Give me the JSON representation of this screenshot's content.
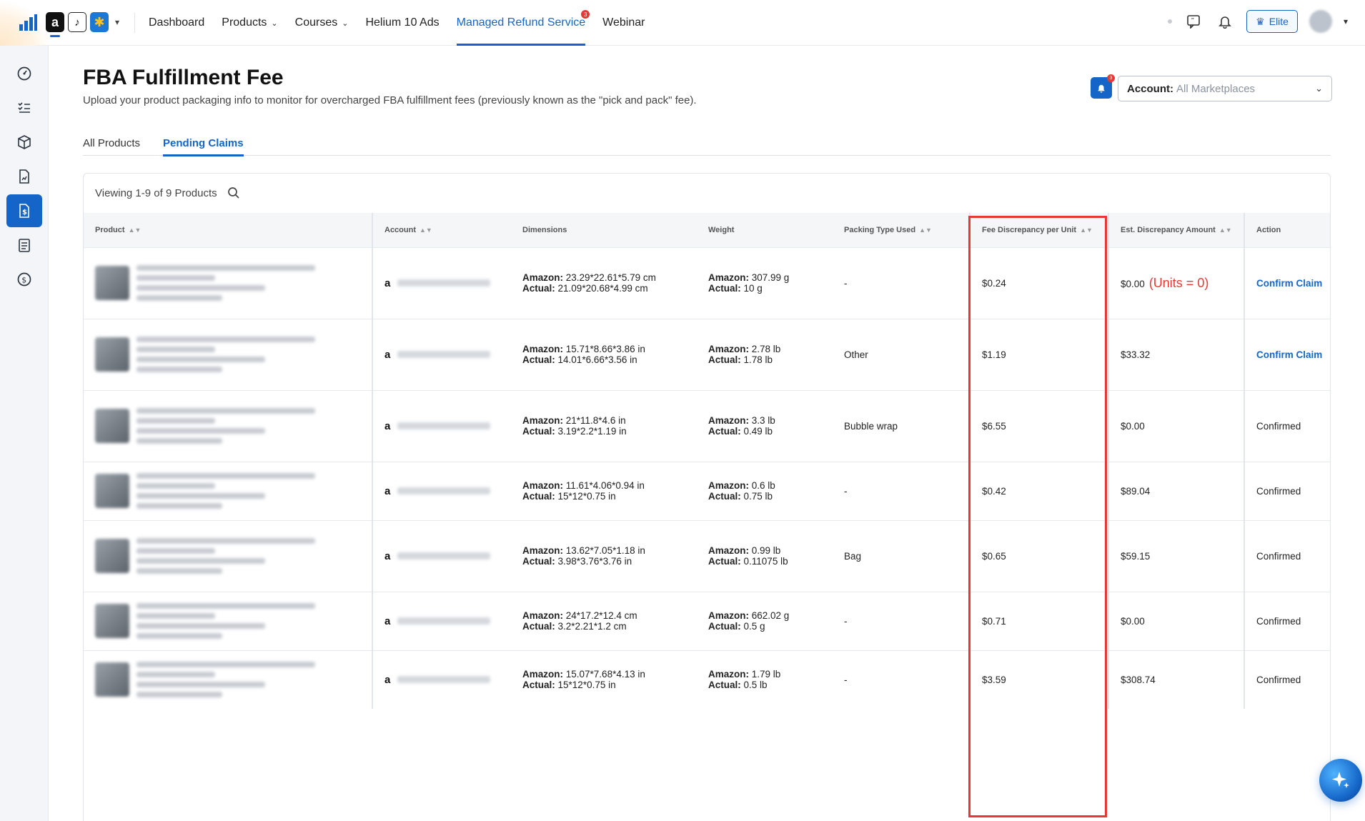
{
  "nav": {
    "items": [
      {
        "label": "Dashboard",
        "caret": false,
        "active": false
      },
      {
        "label": "Products",
        "caret": true,
        "active": false
      },
      {
        "label": "Courses",
        "caret": true,
        "active": false
      },
      {
        "label": "Helium 10 Ads",
        "caret": false,
        "active": false
      },
      {
        "label": "Managed Refund Service",
        "caret": false,
        "active": true,
        "badge": "3"
      },
      {
        "label": "Webinar",
        "caret": false,
        "active": false
      }
    ],
    "plan_label": "Elite"
  },
  "page": {
    "title": "FBA Fulfillment Fee",
    "subtitle": "Upload your product packaging info to monitor for overcharged FBA fulfillment fees (previously known as the \"pick and pack\" fee).",
    "notif_badge": "3",
    "account_label": "Account:",
    "account_value": "All Marketplaces"
  },
  "tabs": [
    {
      "label": "All Products",
      "active": false
    },
    {
      "label": "Pending Claims",
      "active": true
    }
  ],
  "table": {
    "viewing": "Viewing 1-9 of 9 Products",
    "headers": {
      "product": "Product",
      "account": "Account",
      "dimensions": "Dimensions",
      "weight": "Weight",
      "packing": "Packing Type Used",
      "fee": "Fee Discrepancy per Unit",
      "est": "Est. Discrepancy Amount",
      "action": "Action"
    },
    "labels": {
      "amazon": "Amazon:",
      "actual": "Actual:"
    },
    "rows": [
      {
        "dim_amazon": "23.29*22.61*5.79 cm",
        "dim_actual": "21.09*20.68*4.99 cm",
        "w_amazon": "307.99 g",
        "w_actual": "10 g",
        "packing": "-",
        "fee": "$0.24",
        "est": "$0.00",
        "note": "(Units = 0)",
        "action": "Confirm Claim",
        "action_link": true
      },
      {
        "dim_amazon": "15.71*8.66*3.86 in",
        "dim_actual": "14.01*6.66*3.56 in",
        "w_amazon": "2.78 lb",
        "w_actual": "1.78 lb",
        "packing": "Other",
        "fee": "$1.19",
        "est": "$33.32",
        "note": "",
        "action": "Confirm Claim",
        "action_link": true
      },
      {
        "dim_amazon": "21*11.8*4.6 in",
        "dim_actual": "3.19*2.2*1.19 in",
        "w_amazon": "3.3 lb",
        "w_actual": "0.49 lb",
        "packing": "Bubble wrap",
        "fee": "$6.55",
        "est": "$0.00",
        "note": "",
        "action": "Confirmed",
        "action_link": false
      },
      {
        "dim_amazon": "11.61*4.06*0.94 in",
        "dim_actual": "15*12*0.75 in",
        "w_amazon": "0.6 lb",
        "w_actual": "0.75 lb",
        "packing": "-",
        "fee": "$0.42",
        "est": "$89.04",
        "note": "",
        "action": "Confirmed",
        "action_link": false
      },
      {
        "dim_amazon": "13.62*7.05*1.18 in",
        "dim_actual": "3.98*3.76*3.76 in",
        "w_amazon": "0.99 lb",
        "w_actual": "0.11075 lb",
        "packing": "Bag",
        "fee": "$0.65",
        "est": "$59.15",
        "note": "",
        "action": "Confirmed",
        "action_link": false
      },
      {
        "dim_amazon": "24*17.2*12.4 cm",
        "dim_actual": "3.2*2.21*1.2 cm",
        "w_amazon": "662.02 g",
        "w_actual": "0.5 g",
        "packing": "-",
        "fee": "$0.71",
        "est": "$0.00",
        "note": "",
        "action": "Confirmed",
        "action_link": false
      },
      {
        "dim_amazon": "15.07*7.68*4.13 in",
        "dim_actual": "15*12*0.75 in",
        "w_amazon": "1.79 lb",
        "w_actual": "0.5 lb",
        "packing": "-",
        "fee": "$3.59",
        "est": "$308.74",
        "note": "",
        "action": "Confirmed",
        "action_link": false
      }
    ]
  },
  "colors": {
    "accent": "#1465c7",
    "highlight": "#e53935"
  }
}
